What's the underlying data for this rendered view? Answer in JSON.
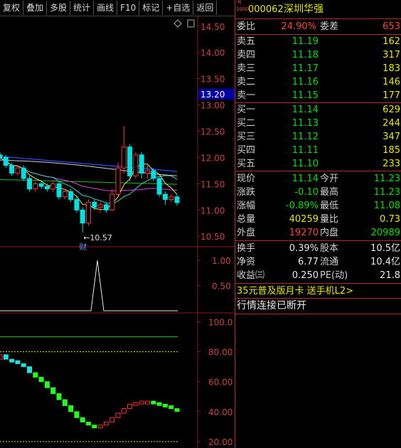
{
  "toolbar": {
    "buttons": [
      "复权",
      "叠加",
      "多股",
      "统计",
      "画线",
      "F10",
      "标记",
      "+自选",
      "返回"
    ]
  },
  "price_axis": {
    "labels": [
      "14.50",
      "14.00",
      "13.50",
      "13.00",
      "12.50",
      "12.00",
      "11.50",
      "11.00",
      "10.50"
    ],
    "current": "13.20",
    "low_marker": "←10.57",
    "event_marker": "财"
  },
  "indicator1_axis": {
    "labels": [
      "1.00",
      "0.50"
    ]
  },
  "indicator2_axis": {
    "labels": [
      "100.0",
      "80.00",
      "60.00",
      "40.00",
      "20.00"
    ]
  },
  "stock": {
    "tag_top": "R",
    "tag_bottom": "1000",
    "code": "000062",
    "name": "深圳华强"
  },
  "weibi": {
    "label": "委比",
    "value": "24.90%",
    "diff_label": "委差",
    "diff_value": "653"
  },
  "asks": [
    {
      "label": "卖五",
      "price": "11.19",
      "vol": "162"
    },
    {
      "label": "卖四",
      "price": "11.18",
      "vol": "317"
    },
    {
      "label": "卖三",
      "price": "11.17",
      "vol": "183"
    },
    {
      "label": "卖二",
      "price": "11.16",
      "vol": "146"
    },
    {
      "label": "卖一",
      "price": "11.15",
      "vol": "177"
    }
  ],
  "bids": [
    {
      "label": "买一",
      "price": "11.14",
      "vol": "629"
    },
    {
      "label": "买二",
      "price": "11.13",
      "vol": "244"
    },
    {
      "label": "买三",
      "price": "11.12",
      "vol": "347"
    },
    {
      "label": "买四",
      "price": "11.11",
      "vol": "185"
    },
    {
      "label": "买五",
      "price": "11.10",
      "vol": "233"
    }
  ],
  "quote": [
    {
      "l1": "现价",
      "v1": "11.14",
      "c1": "green",
      "l2": "今开",
      "v2": "11.23",
      "c2": "green"
    },
    {
      "l1": "涨跌",
      "v1": "-0.10",
      "c1": "green",
      "l2": "最高",
      "v2": "11.23",
      "c2": "green"
    },
    {
      "l1": "涨幅",
      "v1": "-0.89%",
      "c1": "green",
      "l2": "最低",
      "v2": "11.08",
      "c2": "green"
    },
    {
      "l1": "总量",
      "v1": "40259",
      "c1": "yellow",
      "l2": "量比",
      "v2": "0.73",
      "c2": "yellow"
    },
    {
      "l1": "外盘",
      "v1": "19270",
      "c1": "red",
      "l2": "内盘",
      "v2": "20989",
      "c2": "green"
    }
  ],
  "fund": [
    {
      "l1": "换手",
      "v1": "0.39%",
      "l2": "股本",
      "v2": "10.5亿"
    },
    {
      "l1": "净资",
      "v1": "6.77",
      "l2": "流通",
      "v2": "10.4亿"
    },
    {
      "l1": "收益㈢",
      "v1": "0.250",
      "l2": "PE(动)",
      "v2": "21.8"
    }
  ],
  "promo": "35元普及版月卡 送手机L2>",
  "status": "行情连接已断开",
  "colors": {
    "up": "#ff3030",
    "down": "#00e0e0",
    "grid": "#8b1a1a",
    "ma_blue": "#3050ff"
  },
  "chart_data": {
    "type": "candlestick",
    "price_ylim": [
      10.3,
      14.7
    ],
    "candles": [
      [
        12.05,
        12.0,
        12.1,
        11.95
      ],
      [
        12.0,
        11.85,
        12.05,
        11.8
      ],
      [
        11.85,
        11.7,
        11.9,
        11.65
      ],
      [
        11.7,
        11.8,
        11.85,
        11.65
      ],
      [
        11.8,
        11.6,
        11.85,
        11.55
      ],
      [
        11.6,
        11.4,
        11.65,
        11.35
      ],
      [
        11.4,
        11.5,
        11.55,
        11.35
      ],
      [
        11.5,
        11.45,
        11.55,
        11.4
      ],
      [
        11.45,
        11.4,
        11.5,
        11.35
      ],
      [
        11.4,
        11.5,
        11.55,
        11.35
      ],
      [
        11.5,
        11.25,
        11.55,
        11.2
      ],
      [
        11.25,
        11.35,
        11.4,
        11.2
      ],
      [
        11.35,
        11.2,
        11.4,
        11.15
      ],
      [
        11.2,
        11.0,
        11.25,
        10.95
      ],
      [
        11.0,
        10.75,
        11.05,
        10.57
      ],
      [
        10.75,
        11.15,
        11.2,
        10.7
      ],
      [
        11.15,
        11.05,
        11.2,
        11.0
      ],
      [
        11.05,
        11.1,
        11.15,
        10.95
      ],
      [
        11.1,
        11.0,
        11.15,
        10.95
      ],
      [
        11.0,
        11.3,
        11.4,
        10.98
      ],
      [
        11.3,
        11.8,
        11.9,
        11.25
      ],
      [
        11.8,
        12.2,
        12.6,
        11.7
      ],
      [
        12.2,
        11.65,
        12.25,
        11.55
      ],
      [
        11.65,
        12.05,
        12.1,
        11.6
      ],
      [
        12.05,
        11.7,
        12.1,
        11.6
      ],
      [
        11.7,
        11.75,
        11.85,
        11.6
      ],
      [
        11.75,
        11.6,
        11.8,
        11.55
      ],
      [
        11.6,
        11.3,
        11.65,
        11.25
      ],
      [
        11.3,
        11.2,
        11.35,
        11.1
      ],
      [
        11.2,
        11.25,
        11.3,
        11.15
      ],
      [
        11.25,
        11.14,
        11.3,
        11.08
      ]
    ],
    "indicator1_ylim": [
      0,
      1.2
    ],
    "indicator2_ylim": [
      10,
      105
    ],
    "indicator2_values": [
      78,
      75,
      74,
      72,
      70,
      66,
      63,
      60,
      56,
      52,
      48,
      44,
      40,
      36,
      33,
      31,
      30,
      31,
      33,
      36,
      39,
      42,
      45,
      46,
      47,
      47,
      46,
      45,
      44,
      42,
      41
    ]
  }
}
